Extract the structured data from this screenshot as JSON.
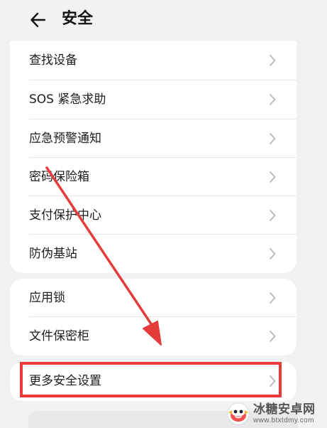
{
  "header": {
    "title": "安全",
    "back_icon": "arrow-left-icon"
  },
  "groups": [
    {
      "items": [
        {
          "label": "查找设备"
        },
        {
          "label": "SOS 紧急求助"
        },
        {
          "label": "应急预警通知"
        },
        {
          "label": "密码保险箱"
        },
        {
          "label": "支付保护中心"
        },
        {
          "label": "防伪基站"
        }
      ]
    },
    {
      "items": [
        {
          "label": "应用锁"
        },
        {
          "label": "文件保密柜"
        }
      ]
    },
    {
      "items": [
        {
          "label": "更多安全设置"
        }
      ]
    }
  ],
  "annotation": {
    "highlight_color": "#ea3a3a",
    "arrow_color": "#e43b3b"
  },
  "watermark": {
    "title": "冰糖安卓网",
    "url": "www.btxtdmy.com",
    "logo_icon": "candy-mascot-icon"
  },
  "colors": {
    "background": "#f1f2f4",
    "card": "#ffffff",
    "text": "#1d1d1d",
    "divider": "#e7e7e7",
    "chevron": "#b8b8b8"
  }
}
